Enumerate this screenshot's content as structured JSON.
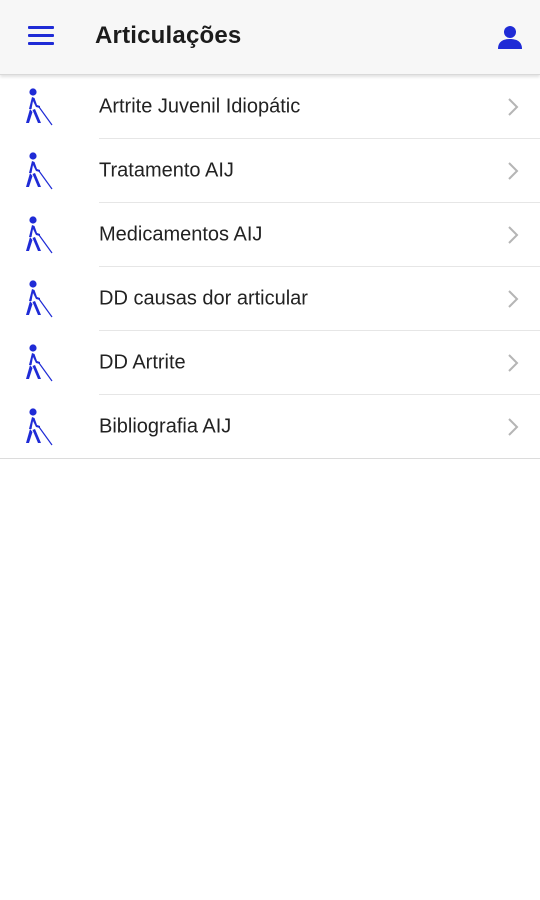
{
  "header": {
    "title": "Articulações",
    "menu_icon": "menu-icon",
    "profile_icon": "person-icon"
  },
  "colors": {
    "accent": "#1f2bd6",
    "chevron": "#b5b5b5"
  },
  "list": {
    "item_icon": "blind-walking-icon",
    "items": [
      {
        "label": "Artrite Juvenil Idiopátic"
      },
      {
        "label": "Tratamento AIJ"
      },
      {
        "label": "Medicamentos AIJ"
      },
      {
        "label": "DD causas dor articular"
      },
      {
        "label": "DD Artrite"
      },
      {
        "label": "Bibliografia AIJ"
      }
    ]
  }
}
